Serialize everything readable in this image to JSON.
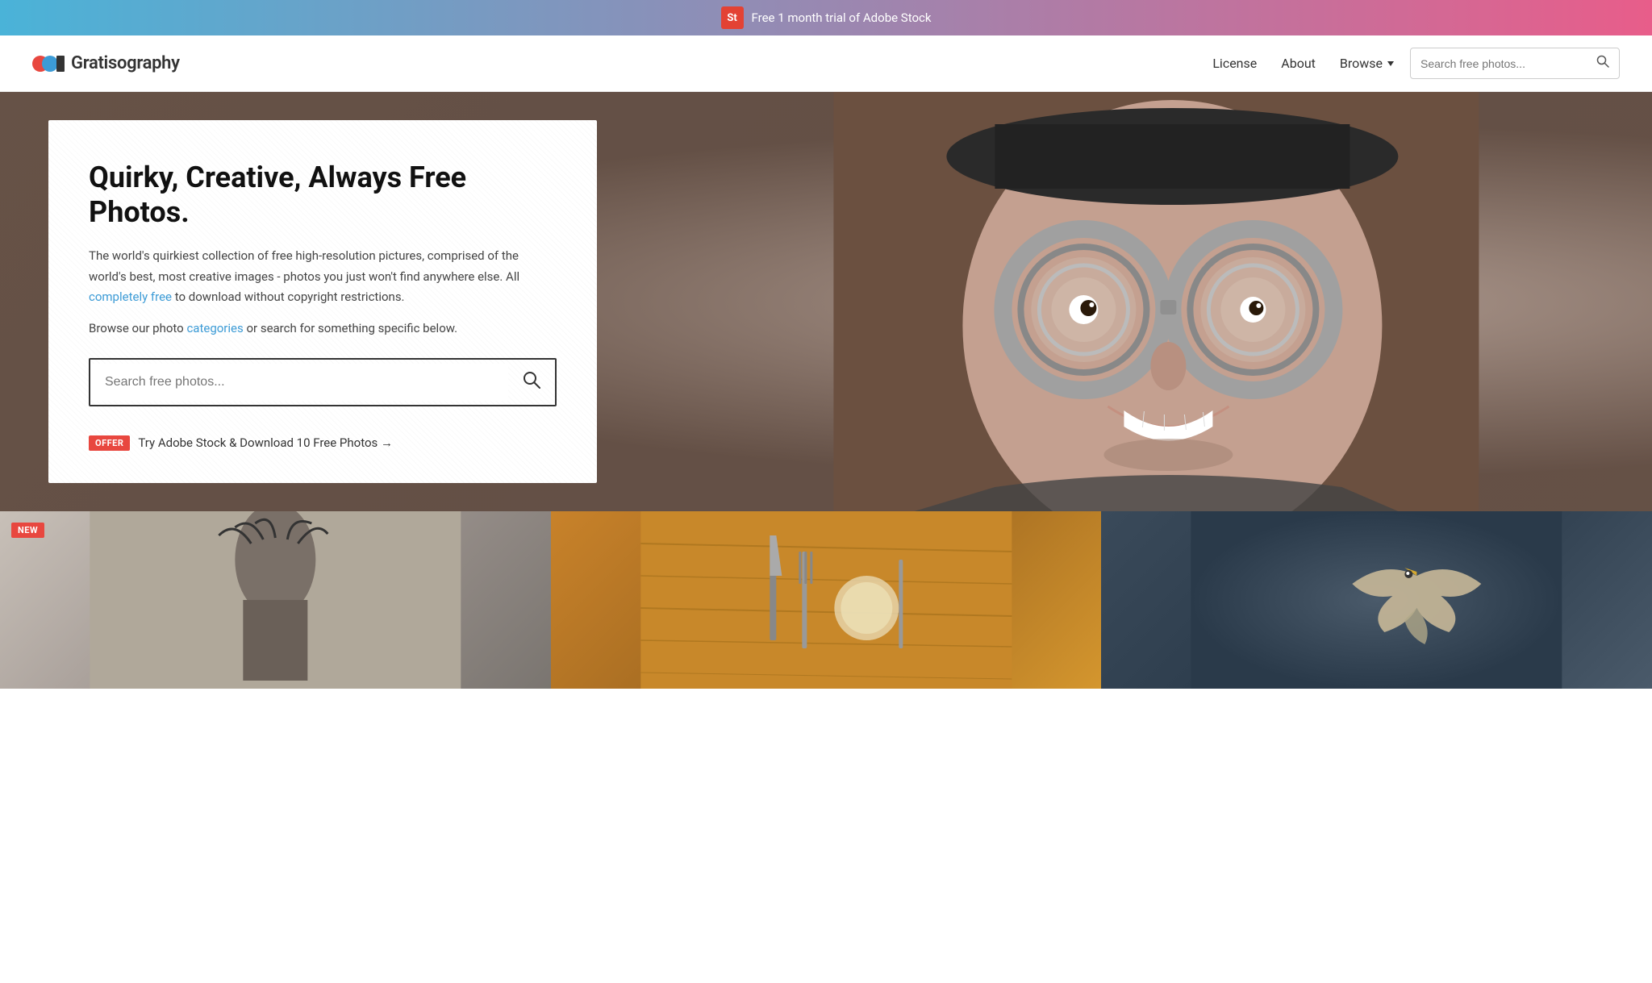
{
  "banner": {
    "adobe_icon_text": "St",
    "text": "Free 1 month trial of Adobe Stock"
  },
  "header": {
    "logo_text": "Gratisography",
    "nav": {
      "license": "License",
      "about": "About",
      "browse": "Browse"
    },
    "search_placeholder": "Search free photos..."
  },
  "hero": {
    "title": "Quirky, Creative, Always Free Photos.",
    "description": "The world's quirkiest collection of free high-resolution pictures, comprised of the world's best, most creative images - photos you just won't find anywhere else. All",
    "free_link": "completely free",
    "description_end": "to download without copyright restrictions.",
    "browse_prefix": "Browse our photo",
    "categories_link": "categories",
    "browse_suffix": "or search for something specific below.",
    "search_placeholder": "Search free photos...",
    "offer_badge": "OFFER",
    "offer_text": "Try Adobe Stock & Download 10 Free Photos →"
  },
  "photo_grid": {
    "badge_new": "NEW"
  }
}
